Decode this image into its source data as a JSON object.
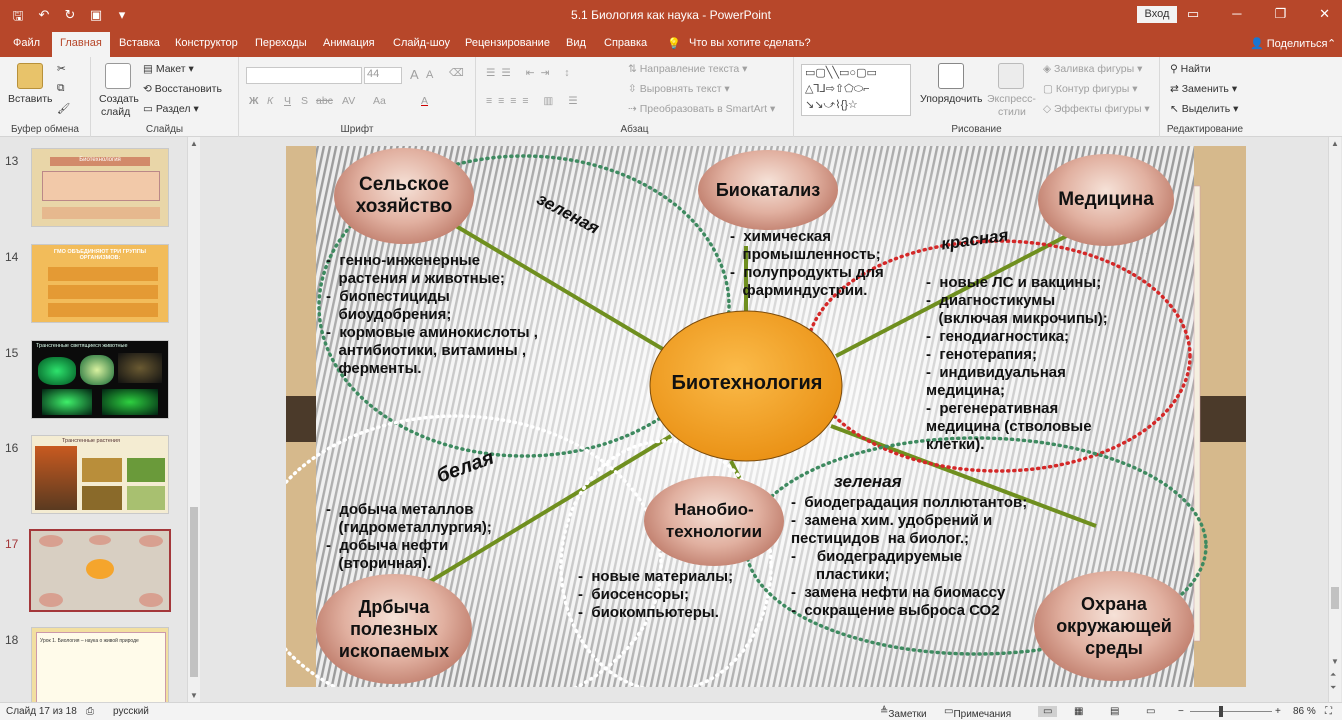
{
  "window": {
    "title": "5.1 Биология как наука  -  PowerPoint",
    "signin_label": "Вход"
  },
  "tabs": [
    "Файл",
    "Главная",
    "Вставка",
    "Конструктор",
    "Переходы",
    "Анимация",
    "Слайд-шоу",
    "Рецензирование",
    "Вид",
    "Справка"
  ],
  "active_tab": "Главная",
  "tell_me": "Что вы хотите сделать?",
  "share_label": "Поделиться",
  "ribbon": {
    "clipboard": {
      "paste": "Вставить",
      "group": "Буфер обмена"
    },
    "slides": {
      "new_slide": "Создать",
      "new_slide2": "слайд",
      "layout": "Макет",
      "reset": "Восстановить",
      "section": "Раздел",
      "group": "Слайды"
    },
    "font": {
      "size": "44",
      "group": "Шрифт",
      "bold": "Ж",
      "italic": "К",
      "underline": "Ч",
      "strike": "S",
      "shadow": "abc",
      "spacing": "AV",
      "case": "Aa",
      "color": "A",
      "grow": "A",
      "shrink": "A"
    },
    "paragraph": {
      "text_direction": "Направление текста",
      "align_text": "Выровнять текст",
      "smartart": "Преобразовать в SmartArt",
      "group": "Абзац"
    },
    "drawing": {
      "arrange": "Упорядочить",
      "quick_styles": "Экспресс-",
      "quick_styles2": "стили",
      "fill": "Заливка фигуры",
      "outline": "Контур фигуры",
      "effects": "Эффекты фигуры",
      "group": "Рисование",
      "shape_glyphs": "▭▢╲╲▭○▢▭ △⅂⅃⇨⇧⬠⬭⌐ ↘↘⤻⌇{}☆"
    },
    "editing": {
      "find": "Найти",
      "replace": "Заменить",
      "select": "Выделить",
      "group": "Редактирование"
    }
  },
  "thumbnails": [
    {
      "num": "13",
      "title": "Биотехнология"
    },
    {
      "num": "14",
      "title": "ГМО ОБЪЕДИНЯЮТ ТРИ ГРУППЫ ОРГАНИЗМОВ:"
    },
    {
      "num": "15",
      "title": "Трансгенные светящиеся животные"
    },
    {
      "num": "16",
      "title": "Трансгенные растения"
    },
    {
      "num": "17",
      "title": ""
    },
    {
      "num": "18",
      "title": "Урок 1. Биология – наука о живой природе"
    }
  ],
  "selected_slide": "17",
  "slide": {
    "center": "Биотехнология",
    "nodes": {
      "agri": "Сельское\nхозяйство",
      "biocat": "Биокатализ",
      "med": "Медицина",
      "mining": "Дрбыча\nполезных\nископаемых",
      "nano": "Нанобио-\nтехнологии",
      "env": "Охрана\nокружающей\nсреды"
    },
    "colors": {
      "green1": "зеленая",
      "red": "красная",
      "white": "белая",
      "green2": "зеленая"
    },
    "texts": {
      "agri": "-  генно-инженерные\n   растения и животные;\n-  биопестициды\n   биоудобрения;\n-  кормовые аминокислоты ,\n   антибиотики, витамины ,\n   ферменты.",
      "biocat": "-  химическая\n   промышленность;\n-  полупродукты для\n   фарминдустрии.",
      "med": "-  новые ЛС и вакцины;\n-  диагностикумы\n   (включая микрочипы);\n-  генодиагностика;\n-  генотерапия;\n-  индивидуальная\nмедицина;\n-  регенеративная\nмедицина (стволовые\nклетки).",
      "mining": "-  добыча металлов\n   (гидрометаллургия);\n-  добыча нефти\n   (вторичная).",
      "nano": "-  новые материалы;\n-  биосенсоры;\n-  биокомпьютеры.",
      "env": "-  биодеградация поллютантов;\n-  замена хим. удобрений и\nпестицидов  на биолог.;\n-     биодеградируемые\n      пластики;\n-  замена нефти на биомассу\n-  сокращение выброса СО2"
    }
  },
  "status": {
    "slide_of": "Слайд 17 из 18",
    "language": "русский",
    "notes": "Заметки",
    "comments": "Примечания",
    "zoom": "86 %"
  },
  "colors": {
    "accent": "#b7472a",
    "center_fill": "#f5a52c",
    "line_green": "#6f8f1f"
  }
}
